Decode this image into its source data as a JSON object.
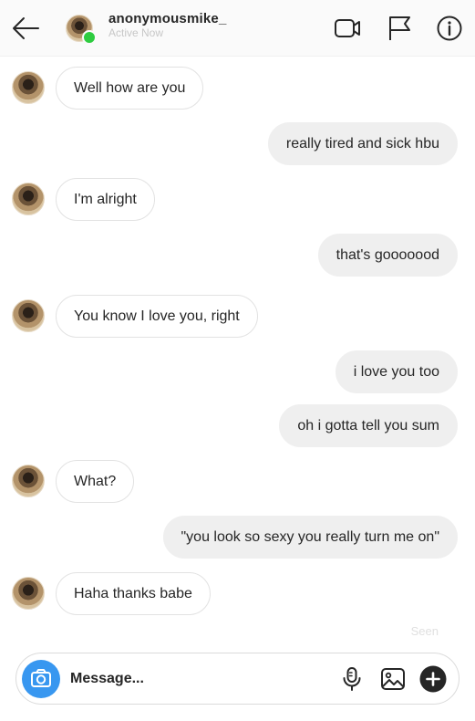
{
  "header": {
    "username": "anonymousmike_",
    "status": "Active Now",
    "icons": [
      "back-arrow-icon",
      "video-call-icon",
      "flag-icon",
      "info-icon"
    ],
    "online_color": "#2ecc40"
  },
  "messages": [
    {
      "from": "them",
      "text": "Well how are you"
    },
    {
      "from": "me",
      "text": "really tired and sick hbu"
    },
    {
      "from": "them",
      "text": "I'm alright"
    },
    {
      "from": "me",
      "text": "that's gooooood"
    },
    {
      "from": "them",
      "text": "You know I love you, right"
    },
    {
      "from": "me",
      "text": "i love you too"
    },
    {
      "from": "me",
      "text": "oh i gotta tell you sum"
    },
    {
      "from": "them",
      "text": "What?"
    },
    {
      "from": "me",
      "text": "\"you look so sexy you really turn me on\""
    },
    {
      "from": "them",
      "text": "Haha thanks babe"
    }
  ],
  "seen_label": "Seen",
  "composer": {
    "placeholder": "Message...",
    "icons": [
      "camera-icon",
      "microphone-icon",
      "gallery-icon",
      "plus-icon"
    ],
    "camera_color": "#3897f0"
  }
}
